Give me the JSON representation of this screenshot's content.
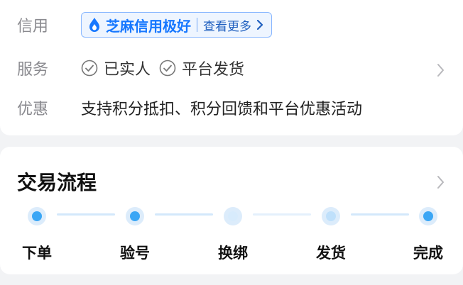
{
  "info": {
    "credit": {
      "label": "信用",
      "badge_text": "芝麻信用极好",
      "more_text": "查看更多"
    },
    "service": {
      "label": "服务",
      "items": [
        "已实人",
        "平台发货"
      ]
    },
    "discount": {
      "label": "优惠",
      "text": "支持积分抵扣、积分回馈和平台优惠活动"
    }
  },
  "process": {
    "title": "交易流程",
    "steps": [
      "下单",
      "验号",
      "换绑",
      "发货",
      "完成"
    ]
  },
  "colors": {
    "accent": "#1677ff",
    "step_active": "#3aa6f5"
  }
}
